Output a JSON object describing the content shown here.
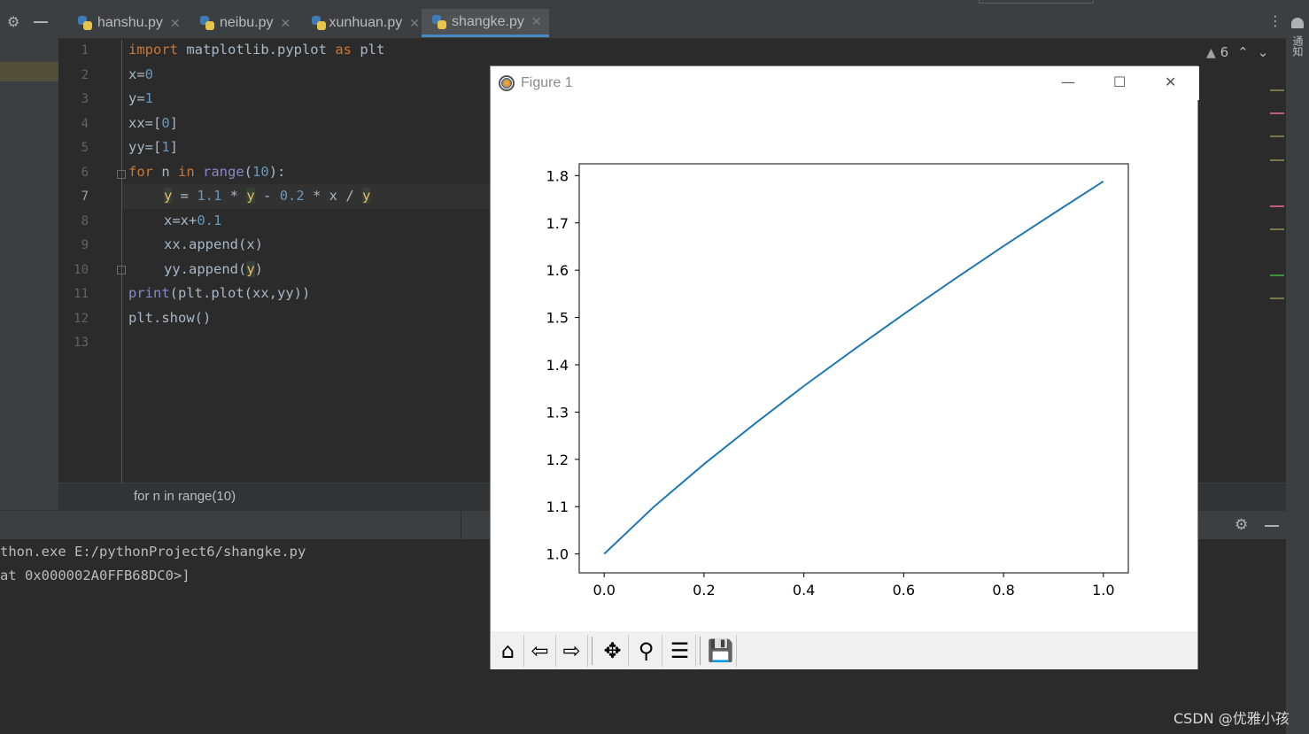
{
  "tabs": [
    {
      "label": "hanshu.py",
      "active": false
    },
    {
      "label": "neibu.py",
      "active": false
    },
    {
      "label": "xunhuan.py",
      "active": false
    },
    {
      "label": "shangke.py",
      "active": true
    }
  ],
  "inspection": {
    "warnings": "6"
  },
  "side_panel_label": "通知",
  "editor": {
    "line_numbers": [
      "1",
      "2",
      "3",
      "4",
      "5",
      "6",
      "7",
      "8",
      "9",
      "10",
      "11",
      "12",
      "13"
    ],
    "lines": {
      "l1": {
        "k1": "import",
        "t1": " matplotlib.pyplot ",
        "k2": "as",
        "t2": " plt"
      },
      "l2": {
        "t1": "x=",
        "n1": "0"
      },
      "l3": {
        "t1": "y=",
        "n1": "1"
      },
      "l4": {
        "t1": "xx=[",
        "n1": "0",
        "t2": "]"
      },
      "l5": {
        "t1": "yy=[",
        "n1": "1",
        "t2": "]"
      },
      "l6": {
        "k1": "for",
        "t1": " n ",
        "k2": "in",
        "b1": " range",
        "t2": "(",
        "n1": "10",
        "t3": "):"
      },
      "l7": {
        "v1": "y",
        "t1": " = ",
        "n1": "1.1",
        "t2": " * ",
        "v2": "y",
        "t3": " - ",
        "n2": "0.2",
        "t4": " * x / ",
        "v3": "y"
      },
      "l8": {
        "t1": "x=x+",
        "n1": "0.1"
      },
      "l9": {
        "t1": "xx.append(x)"
      },
      "l10": {
        "t1": "yy.append(",
        "v1": "y",
        "t2": ")"
      },
      "l11": {
        "b1": "print",
        "t1": "(plt.plot(xx,yy))"
      },
      "l12": {
        "t1": "plt.show()"
      }
    }
  },
  "breadcrumb": "for n in range(10)",
  "console": {
    "line1": "thon.exe E:/pythonProject6/shangke.py",
    "line2": "at 0x000002A0FFB68DC0>]"
  },
  "watermark": "CSDN @优雅小孩",
  "figure": {
    "window_title": "Figure 1",
    "toolbar": [
      "home-icon",
      "back-icon",
      "forward-icon",
      "pan-icon",
      "zoom-icon",
      "configure-subplots-icon",
      "save-icon"
    ]
  },
  "chart_data": {
    "type": "line",
    "x": [
      0,
      0.1,
      0.2,
      0.3,
      0.4,
      0.5,
      0.6,
      0.7,
      0.8,
      0.9,
      1.0
    ],
    "series": [
      {
        "values": [
          1.0,
          1.1,
          1.19,
          1.274,
          1.355,
          1.432,
          1.507,
          1.58,
          1.651,
          1.72,
          1.788
        ],
        "color": "#1f77b4"
      }
    ],
    "xticks": [
      "0.0",
      "0.2",
      "0.4",
      "0.6",
      "0.8",
      "1.0"
    ],
    "yticks": [
      "1.0",
      "1.1",
      "1.2",
      "1.3",
      "1.4",
      "1.5",
      "1.6",
      "1.7",
      "1.8"
    ],
    "xlim": [
      -0.05,
      1.05
    ],
    "ylim": [
      0.96,
      1.825
    ],
    "title": "",
    "xlabel": "",
    "ylabel": "",
    "grid": false
  }
}
